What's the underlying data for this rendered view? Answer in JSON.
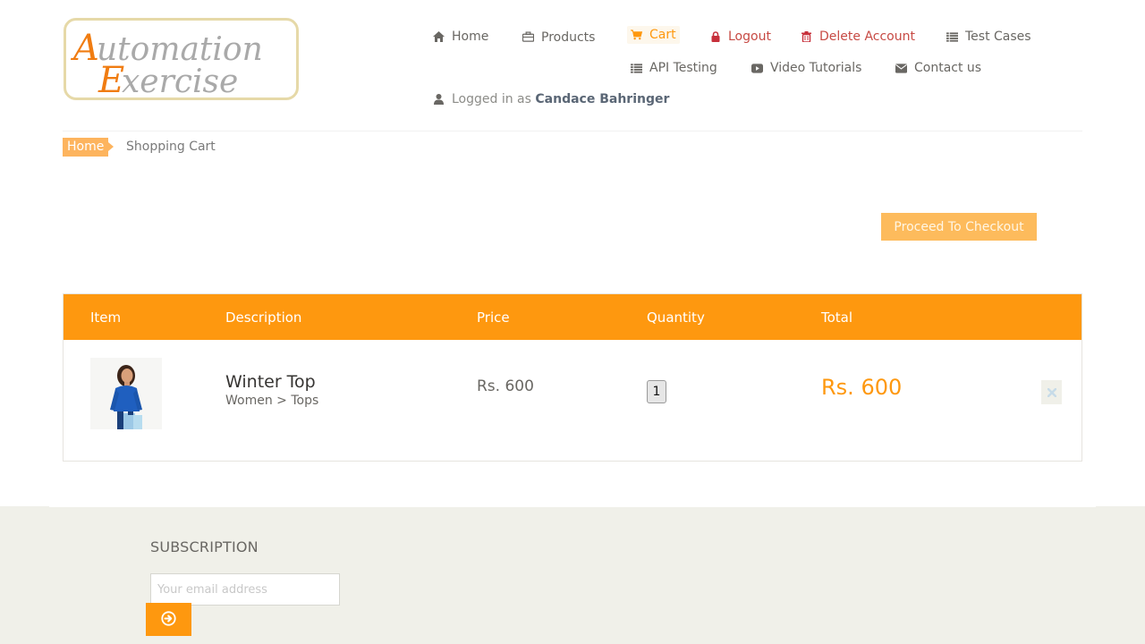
{
  "logo": {
    "line1": "Automation",
    "line2": "Exercise"
  },
  "nav": {
    "home": {
      "label": "Home",
      "icon": "home-icon"
    },
    "products": {
      "label": "Products",
      "icon": "briefcase-icon"
    },
    "cart": {
      "label": "Cart",
      "icon": "shopping-cart-icon"
    },
    "logout": {
      "label": "Logout",
      "icon": "lock-icon"
    },
    "delete_account": {
      "label": "Delete Account",
      "icon": "trash-icon"
    },
    "test_cases": {
      "label": "Test Cases",
      "icon": "list-icon"
    },
    "api_testing": {
      "label": "API Testing",
      "icon": "list-icon"
    },
    "video_tutorials": {
      "label": "Video Tutorials",
      "icon": "youtube-play-icon"
    },
    "contact_us": {
      "label": "Contact us",
      "icon": "envelope-icon"
    },
    "logged_in_prefix": "Logged in as",
    "logged_in_user": "Candace Bahringer"
  },
  "breadcrumb": {
    "home": "Home",
    "current": "Shopping Cart"
  },
  "checkout": {
    "label": "Proceed To Checkout"
  },
  "cart_table": {
    "headers": {
      "item": "Item",
      "description": "Description",
      "price": "Price",
      "quantity": "Quantity",
      "total": "Total"
    },
    "rows": [
      {
        "name": "Winter Top",
        "category": "Women > Tops",
        "price": "Rs. 600",
        "quantity": "1",
        "total": "Rs. 600"
      }
    ]
  },
  "footer": {
    "subscription_title": "SUBSCRIPTION",
    "email_placeholder": "Your email address"
  },
  "colors": {
    "accent": "#fe980f",
    "accent_light": "#fdbb5c",
    "footer_bg": "#f0f0e9",
    "danger": "#c7303b"
  }
}
